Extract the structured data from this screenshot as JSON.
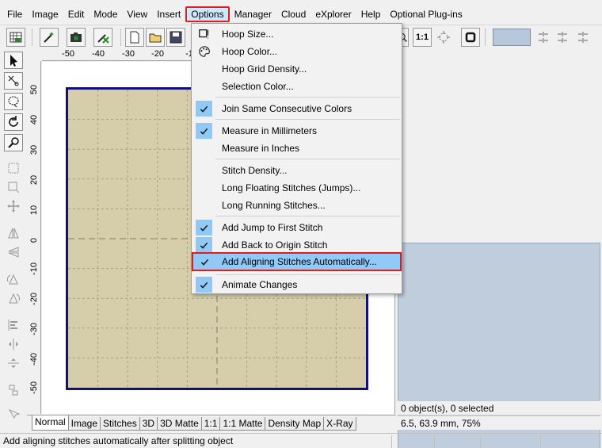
{
  "menubar": {
    "items": [
      "File",
      "Image",
      "Edit",
      "Mode",
      "View",
      "Insert",
      "Options",
      "Manager",
      "Cloud",
      "eXplorer",
      "Help",
      "Optional Plug-ins"
    ],
    "active": "Options"
  },
  "ruler": {
    "h_labels": [
      "-50",
      "-40",
      "-30",
      "-20",
      "-1"
    ],
    "v_labels": [
      "50",
      "40",
      "30",
      "20",
      "10",
      "0",
      "-10",
      "-20",
      "-30",
      "-40",
      "-50"
    ]
  },
  "options_menu": {
    "hoop_size": "Hoop Size...",
    "hoop_color": "Hoop Color...",
    "hoop_grid_density": "Hoop Grid Density...",
    "selection_color": "Selection Color...",
    "join_same_colors": "Join Same Consecutive Colors",
    "measure_mm": "Measure in Millimeters",
    "measure_in": "Measure in Inches",
    "stitch_density": "Stitch Density...",
    "long_floating": "Long Floating Stitches (Jumps)...",
    "long_running": "Long Running Stitches...",
    "add_jump_first": "Add Jump to First Stitch",
    "add_back_origin": "Add Back to Origin Stitch",
    "add_aligning": "Add Aligning Stitches Automatically...",
    "animate_changes": "Animate Changes"
  },
  "tabs": [
    "Normal",
    "Image",
    "Stitches",
    "3D",
    "3D Matte",
    "1:1",
    "1:1 Matte",
    "Density Map",
    "X-Ray"
  ],
  "active_tab": "Normal",
  "info": {
    "objects": "0 object(s), 0 selected",
    "coords": "6.5, 63.9 mm, 75%"
  },
  "toolbar": {
    "ratio_label": "1:1"
  },
  "status": {
    "text": "Add aligning stitches automatically after splitting object"
  },
  "colors": {
    "hoop_fill": "#d6ceaa",
    "hoop_border": "#10107a",
    "menu_highlight": "#91c9f7",
    "callout_red": "#e01c1c",
    "preview_bg": "#bfcddd"
  }
}
